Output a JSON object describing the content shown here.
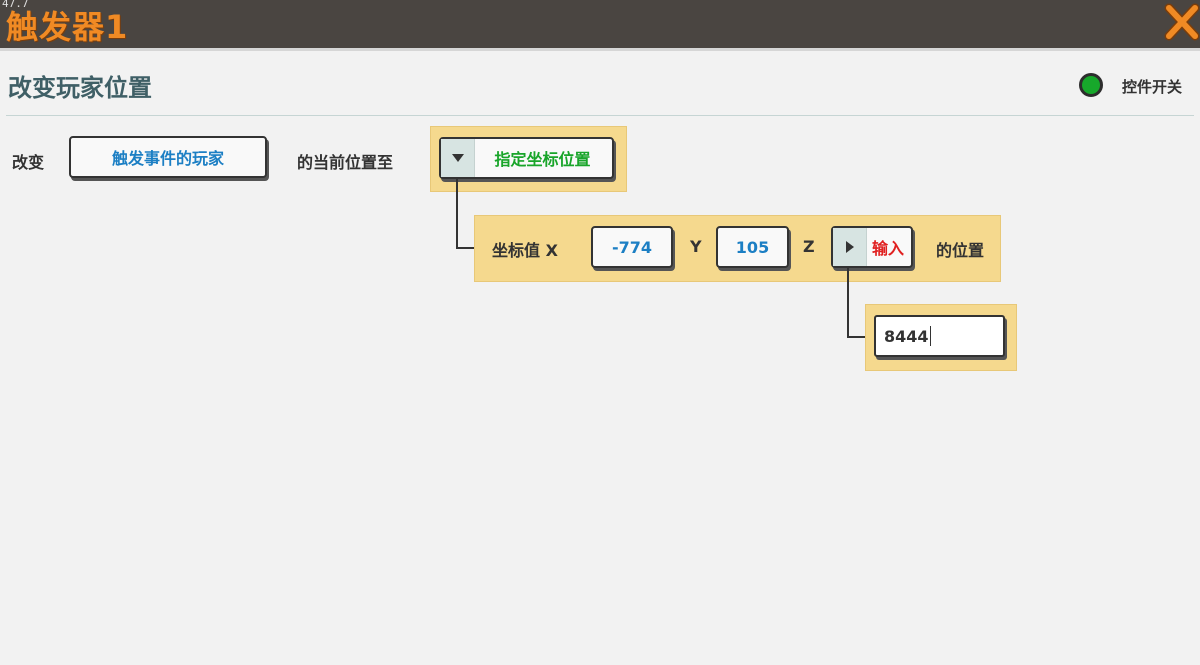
{
  "titlebar": {
    "corner_text": "47.7",
    "title": "触发器1"
  },
  "header": {
    "action_title": "改变玩家位置",
    "switch_label": "控件开关",
    "switch_color": "#17a82b"
  },
  "sentence": {
    "prefix": "改变",
    "player_selector": "触发事件的玩家",
    "middle": "的当前位置至",
    "position_mode": "指定坐标位置"
  },
  "coordinates": {
    "label": "坐标值 X",
    "x_value": "-774",
    "y_label": "Y",
    "y_value": "105",
    "z_label": "Z",
    "z_mode": "输入",
    "suffix": "的位置"
  },
  "z_input": {
    "value": "8444"
  },
  "colors": {
    "title_orange": "#f08a24",
    "link_blue": "#1c7fc4",
    "mode_green": "#19a52a",
    "input_red": "#e02020",
    "panel_yellow": "#f5d98e"
  }
}
